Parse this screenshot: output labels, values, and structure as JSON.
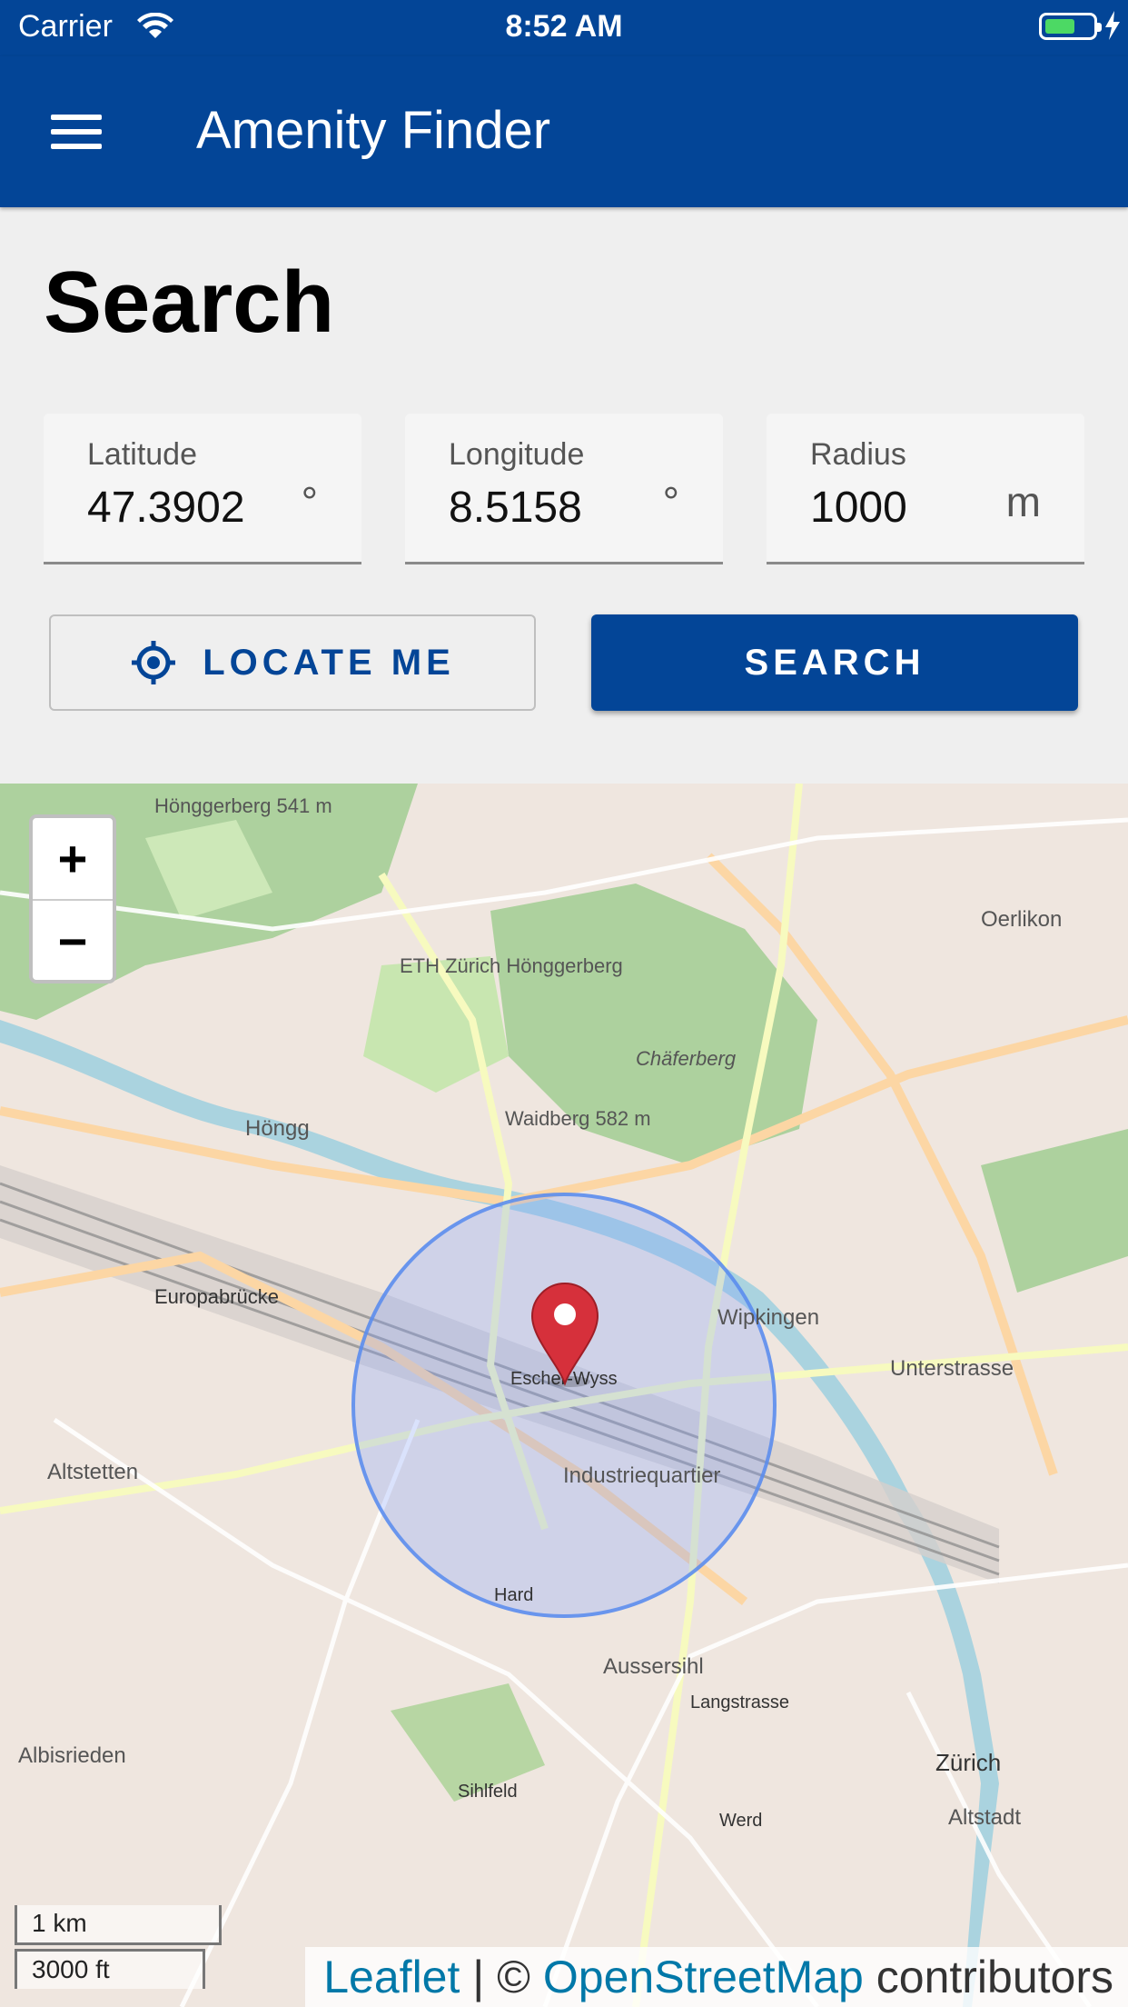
{
  "status_bar": {
    "carrier": "Carrier",
    "time": "8:52 AM"
  },
  "app_bar": {
    "title": "Amenity Finder"
  },
  "page": {
    "title": "Search"
  },
  "form": {
    "latitude": {
      "label": "Latitude",
      "value": "47.3902",
      "unit": "°"
    },
    "longitude": {
      "label": "Longitude",
      "value": "8.5158",
      "unit": "°"
    },
    "radius": {
      "label": "Radius",
      "value": "1000",
      "unit": "m"
    }
  },
  "buttons": {
    "locate": "LOCATE ME",
    "search": "SEARCH"
  },
  "map": {
    "zoom_in": "+",
    "zoom_out": "−",
    "scale_metric": "1 km",
    "scale_imperial": "3000 ft",
    "attribution": {
      "leaflet": "Leaflet",
      "separator": " | © ",
      "osm": "OpenStreetMap",
      "suffix": " contributors"
    },
    "labels": [
      "Hönggerberg 541 m",
      "ETH Zürich Hönggerberg",
      "Chäferberg",
      "Oerlikon",
      "Waidberg 582 m",
      "Höngg",
      "Europabrücke",
      "Wipkingen",
      "Escher-Wyss",
      "Industriequartier",
      "Unterstrasse",
      "Altstetten",
      "Aussersihl",
      "Zürich",
      "Albisrieden",
      "Altstadt",
      "Hard",
      "Langstrasse",
      "Sihlfeld",
      "Werd"
    ],
    "colors": {
      "primary": "#034597",
      "radius_fill": "#7a9cff",
      "marker": "#d6303b"
    }
  }
}
